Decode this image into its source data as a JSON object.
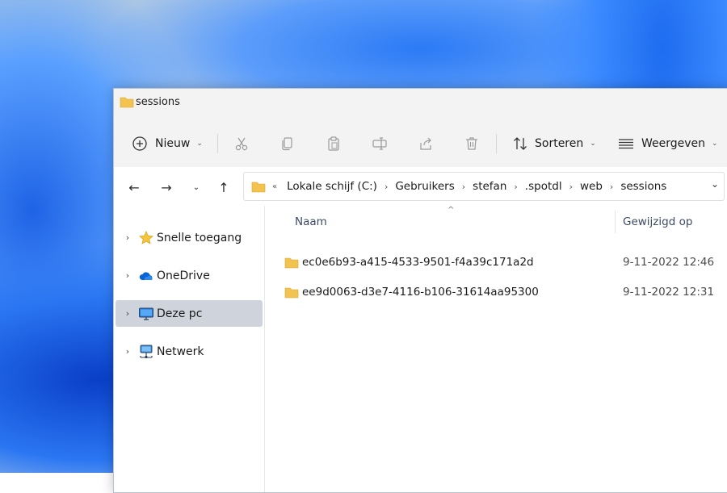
{
  "window": {
    "title": "sessions"
  },
  "toolbar": {
    "new_label": "Nieuw",
    "sort_label": "Sorteren",
    "view_label": "Weergeven"
  },
  "address": {
    "overflow": "«",
    "crumbs": [
      "Lokale schijf (C:)",
      "Gebruikers",
      "stefan",
      ".spotdl",
      "web",
      "sessions"
    ]
  },
  "sidebar": {
    "items": [
      {
        "label": "Snelle toegang",
        "icon": "star-icon"
      },
      {
        "label": "OneDrive",
        "icon": "cloud-icon"
      },
      {
        "label": "Deze pc",
        "icon": "computer-icon",
        "selected": true
      },
      {
        "label": "Netwerk",
        "icon": "network-icon"
      }
    ]
  },
  "list": {
    "columns": {
      "name": "Naam",
      "modified": "Gewijzigd op"
    },
    "rows": [
      {
        "name": "ec0e6b93-a415-4533-9501-f4a39c171a2d",
        "modified": "9-11-2022 12:46"
      },
      {
        "name": "ee9d0063-d3e7-4116-b106-31614aa95300",
        "modified": "9-11-2022 12:31"
      }
    ]
  },
  "colors": {
    "folder": "#f2c34f",
    "selected_bg": "#cfd4dc",
    "accent": "#0067c0"
  }
}
